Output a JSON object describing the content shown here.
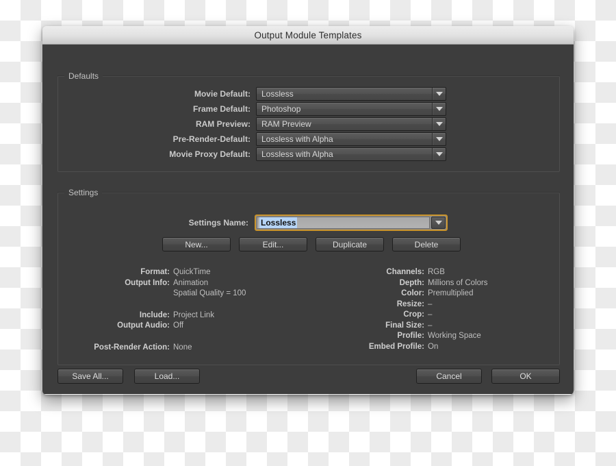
{
  "window": {
    "title": "Output Module Templates"
  },
  "defaults": {
    "group_label": "Defaults",
    "rows": [
      {
        "label": "Movie Default:",
        "value": "Lossless",
        "icon": "chevron-down-icon"
      },
      {
        "label": "Frame Default:",
        "value": "Photoshop",
        "icon": "chevron-down-icon"
      },
      {
        "label": "RAM Preview:",
        "value": "RAM Preview",
        "icon": "chevron-down-icon"
      },
      {
        "label": "Pre-Render-Default:",
        "value": "Lossless with Alpha",
        "icon": "chevron-down-icon"
      },
      {
        "label": "Movie Proxy Default:",
        "value": "Lossless with Alpha",
        "icon": "chevron-down-icon"
      }
    ]
  },
  "settings": {
    "group_label": "Settings",
    "name_label": "Settings Name:",
    "name_value": "Lossless",
    "name_icon": "chevron-down-icon",
    "focus_ring_color": "#c8922a",
    "selection_color": "#b6d4f5",
    "buttons": [
      {
        "label": "New..."
      },
      {
        "label": "Edit..."
      },
      {
        "label": "Duplicate"
      },
      {
        "label": "Delete"
      }
    ],
    "info_left": [
      {
        "label": "Format:",
        "value": "QuickTime"
      },
      {
        "label": "Output Info:",
        "value": "Animation"
      },
      {
        "label": "",
        "value": "Spatial Quality = 100"
      },
      {
        "label": "Include:",
        "value": "Project Link"
      },
      {
        "label": "Output Audio:",
        "value": "Off"
      },
      {
        "label": "Post-Render Action:",
        "value": "None"
      }
    ],
    "info_right": [
      {
        "label": "Channels:",
        "value": "RGB"
      },
      {
        "label": "Depth:",
        "value": "Millions of Colors"
      },
      {
        "label": "Color:",
        "value": "Premultiplied"
      },
      {
        "label": "Resize:",
        "value": "–"
      },
      {
        "label": "Crop:",
        "value": "–"
      },
      {
        "label": "Final Size:",
        "value": "–"
      },
      {
        "label": "Profile:",
        "value": "Working Space"
      },
      {
        "label": "Embed Profile:",
        "value": "On"
      }
    ]
  },
  "footer": {
    "save_all_label": "Save All...",
    "load_label": "Load...",
    "cancel_label": "Cancel",
    "ok_label": "OK"
  }
}
